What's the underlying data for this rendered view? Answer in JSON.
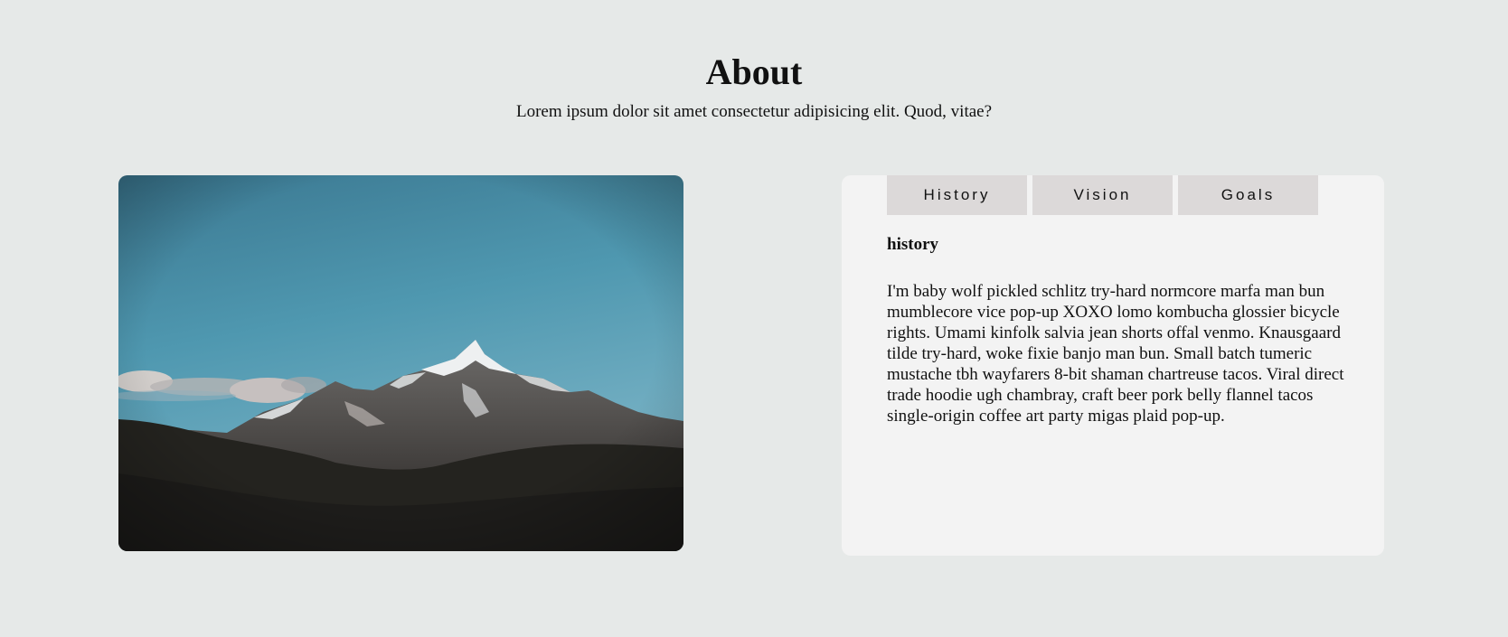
{
  "header": {
    "title": "About",
    "subtitle": "Lorem ipsum dolor sit amet consectetur adipisicing elit. Quod, vitae?"
  },
  "image": {
    "subject": "mountain-landscape",
    "colors": {
      "sky_top": "#3f7f98",
      "sky_bottom": "#77b0c6",
      "forest": "#22211f",
      "snow": "#eef0f1"
    }
  },
  "tabs": [
    {
      "label": "History"
    },
    {
      "label": "Vision"
    },
    {
      "label": "Goals"
    }
  ],
  "panel": {
    "heading": "history",
    "body": "I'm baby wolf pickled schlitz try-hard normcore marfa man bun mumblecore vice pop-up XOXO lomo kombucha glossier bicycle rights. Umami kinfolk salvia jean shorts offal venmo. Knausgaard tilde try-hard, woke fixie banjo man bun. Small batch tumeric mustache tbh wayfarers 8-bit shaman chartreuse tacos. Viral direct trade hoodie ugh chambray, craft beer pork belly flannel tacos single-origin coffee art party migas plaid pop-up."
  },
  "colors": {
    "page_background": "#e6e9e8",
    "card_background": "#f3f3f3",
    "tab_background": "#dcd9d9"
  }
}
